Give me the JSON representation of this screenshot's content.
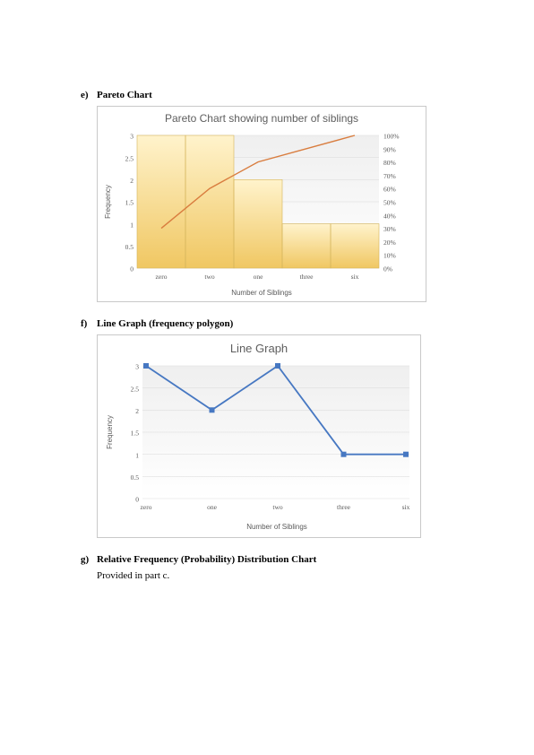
{
  "sections": {
    "e": {
      "letter": "e)",
      "title": "Pareto Chart"
    },
    "f": {
      "letter": "f)",
      "title": "Line Graph (frequency polygon)"
    },
    "g": {
      "letter": "g)",
      "title": "Relative Frequency (Probability) Distribution Chart",
      "body": "Provided in part c."
    }
  },
  "chart_data": [
    {
      "id": "pareto",
      "type": "bar",
      "title": "Pareto Chart showing number of siblings",
      "xlabel": "Number of Siblings",
      "ylabel": "Frequency",
      "categories": [
        "zero",
        "two",
        "one",
        "three",
        "six"
      ],
      "values": [
        3,
        3,
        2,
        1,
        1
      ],
      "ylim": [
        0,
        3
      ],
      "yticks": [
        0,
        0.5,
        1,
        1.5,
        2,
        2.5,
        3
      ],
      "y2ticks": [
        "0%",
        "10%",
        "20%",
        "30%",
        "40%",
        "50%",
        "60%",
        "70%",
        "80%",
        "90%",
        "100%"
      ],
      "cumulative_pct": [
        30,
        60,
        80,
        90,
        100
      ]
    },
    {
      "id": "linegraph",
      "type": "line",
      "title": "Line Graph",
      "xlabel": "Number of Siblings",
      "ylabel": "Frequency",
      "categories": [
        "zero",
        "one",
        "two",
        "three",
        "six"
      ],
      "values": [
        3,
        2,
        3,
        1,
        1
      ],
      "ylim": [
        0,
        3
      ],
      "yticks": [
        0,
        0.5,
        1,
        1.5,
        2,
        2.5,
        3
      ]
    }
  ]
}
